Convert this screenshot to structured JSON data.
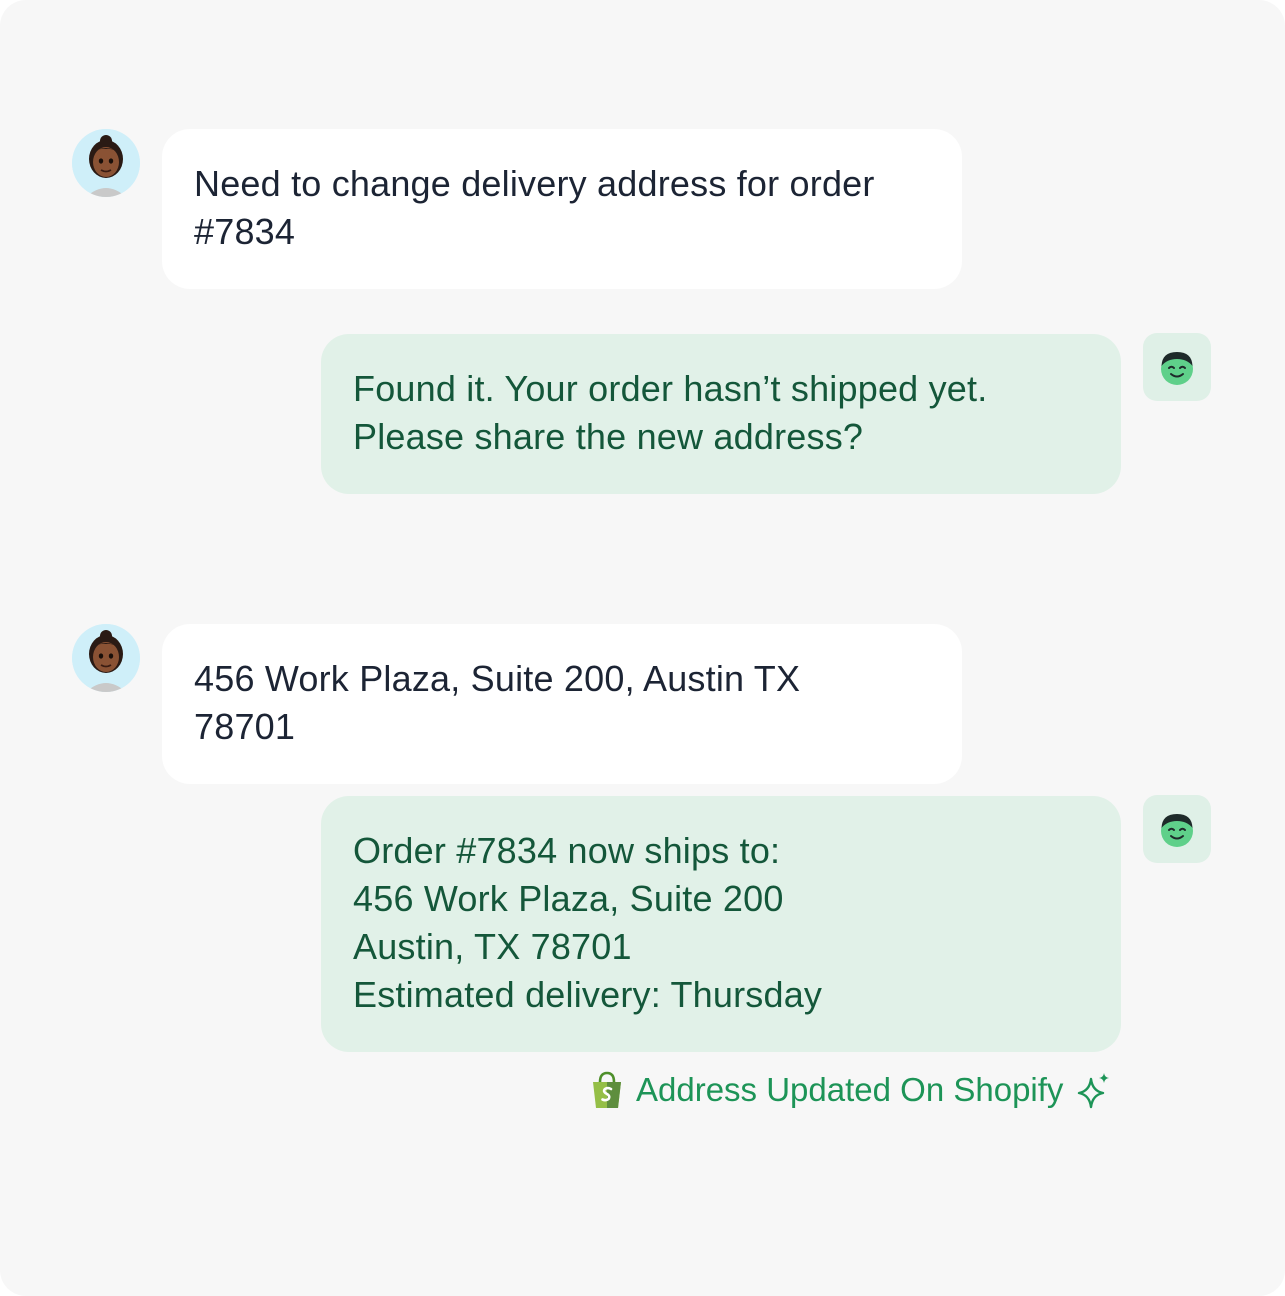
{
  "messages": [
    {
      "sender": "user",
      "avatar_icon": "woman-avatar-icon",
      "lines": [
        "Need to change delivery address for order",
        "#7834"
      ]
    },
    {
      "sender": "bot",
      "avatar_icon": "bot-face-icon",
      "lines": [
        "Found it. Your order hasn’t shipped yet.",
        "Please share the new address?"
      ]
    },
    {
      "sender": "user",
      "avatar_icon": "woman-avatar-icon",
      "lines": [
        "456 Work Plaza, Suite 200, Austin TX",
        "78701"
      ]
    },
    {
      "sender": "bot",
      "avatar_icon": "bot-face-icon",
      "lines": [
        "Order #7834 now ships to:",
        "456 Work Plaza, Suite 200",
        "Austin, TX 78701",
        "Estimated delivery: Thursday"
      ]
    }
  ],
  "status": {
    "label": "Address Updated On Shopify",
    "leading_icon": "shopify-bag-icon",
    "trailing_icon": "sparkle-icon",
    "color": "#1d9457"
  },
  "colors": {
    "background": "#f7f7f7",
    "user_bubble": "#ffffff",
    "user_text": "#1c2434",
    "bot_bubble": "#e1f1e8",
    "bot_text": "#14573a"
  }
}
